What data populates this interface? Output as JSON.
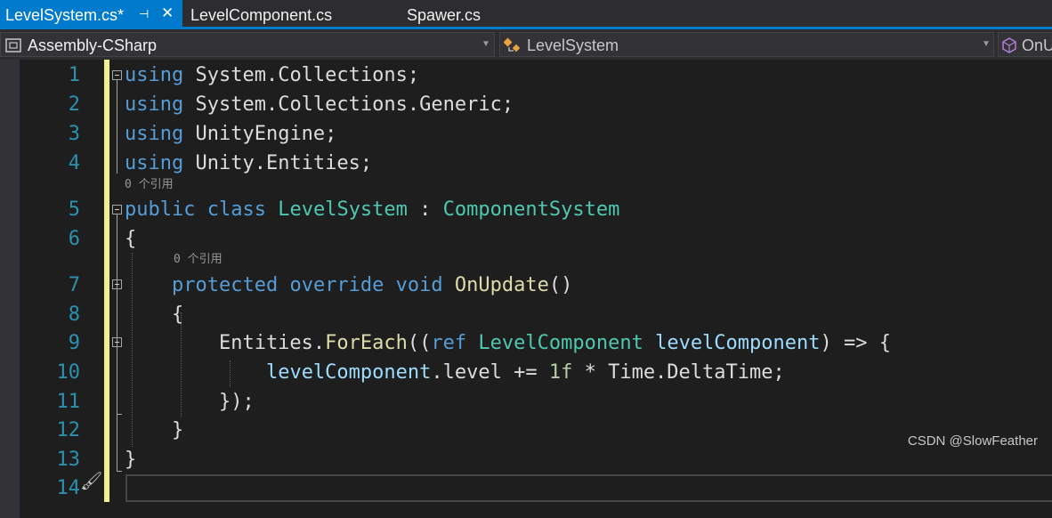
{
  "tabs": [
    {
      "label": "LevelSystem.cs*",
      "active": true,
      "pin": "⊣",
      "close": "✕"
    },
    {
      "label": "LevelComponent.cs",
      "active": false
    },
    {
      "label": "Spawer.cs",
      "active": false
    }
  ],
  "navbar": {
    "project": "Assembly-CSharp",
    "type": "LevelSystem",
    "member": "OnU"
  },
  "editor": {
    "line_numbers": [
      "1",
      "2",
      "3",
      "4",
      "5",
      "6",
      "7",
      "8",
      "9",
      "10",
      "11",
      "12",
      "13",
      "14"
    ],
    "reference_hint": "0 个引用",
    "lines": [
      [
        {
          "t": "kw",
          "s": "using"
        },
        {
          "t": "",
          "s": " System.Collections;"
        }
      ],
      [
        {
          "t": "kw",
          "s": "using"
        },
        {
          "t": "",
          "s": " System.Collections.Generic;"
        }
      ],
      [
        {
          "t": "kw",
          "s": "using"
        },
        {
          "t": "",
          "s": " UnityEngine;"
        }
      ],
      [
        {
          "t": "kw",
          "s": "using"
        },
        {
          "t": "",
          "s": " Unity.Entities;"
        }
      ],
      [
        {
          "t": "kw",
          "s": "public"
        },
        {
          "t": "",
          "s": " "
        },
        {
          "t": "kw",
          "s": "class"
        },
        {
          "t": "",
          "s": " "
        },
        {
          "t": "ty",
          "s": "LevelSystem"
        },
        {
          "t": "",
          "s": " : "
        },
        {
          "t": "ty",
          "s": "ComponentSystem"
        }
      ],
      [
        {
          "t": "",
          "s": "{"
        }
      ],
      [
        {
          "t": "",
          "s": "    "
        },
        {
          "t": "kw",
          "s": "protected"
        },
        {
          "t": "",
          "s": " "
        },
        {
          "t": "kw",
          "s": "override"
        },
        {
          "t": "",
          "s": " "
        },
        {
          "t": "kw",
          "s": "void"
        },
        {
          "t": "",
          "s": " "
        },
        {
          "t": "fn",
          "s": "OnUpdate"
        },
        {
          "t": "",
          "s": "()"
        }
      ],
      [
        {
          "t": "",
          "s": "    {"
        }
      ],
      [
        {
          "t": "",
          "s": "        Entities."
        },
        {
          "t": "fn",
          "s": "ForEach"
        },
        {
          "t": "",
          "s": "(("
        },
        {
          "t": "kw",
          "s": "ref"
        },
        {
          "t": "",
          "s": " "
        },
        {
          "t": "ty",
          "s": "LevelComponent"
        },
        {
          "t": "",
          "s": " "
        },
        {
          "t": "pm",
          "s": "levelComponent"
        },
        {
          "t": "",
          "s": ") => {"
        }
      ],
      [
        {
          "t": "",
          "s": "            "
        },
        {
          "t": "pm",
          "s": "levelComponent"
        },
        {
          "t": "",
          "s": ".level += "
        },
        {
          "t": "nm",
          "s": "1f"
        },
        {
          "t": "",
          "s": " * Time.DeltaTime;"
        }
      ],
      [
        {
          "t": "",
          "s": "        });"
        }
      ],
      [
        {
          "t": "",
          "s": "    }"
        }
      ],
      [
        {
          "t": "",
          "s": "}"
        }
      ],
      [
        {
          "t": "",
          "s": ""
        }
      ]
    ]
  },
  "watermark": "CSDN @SlowFeather"
}
